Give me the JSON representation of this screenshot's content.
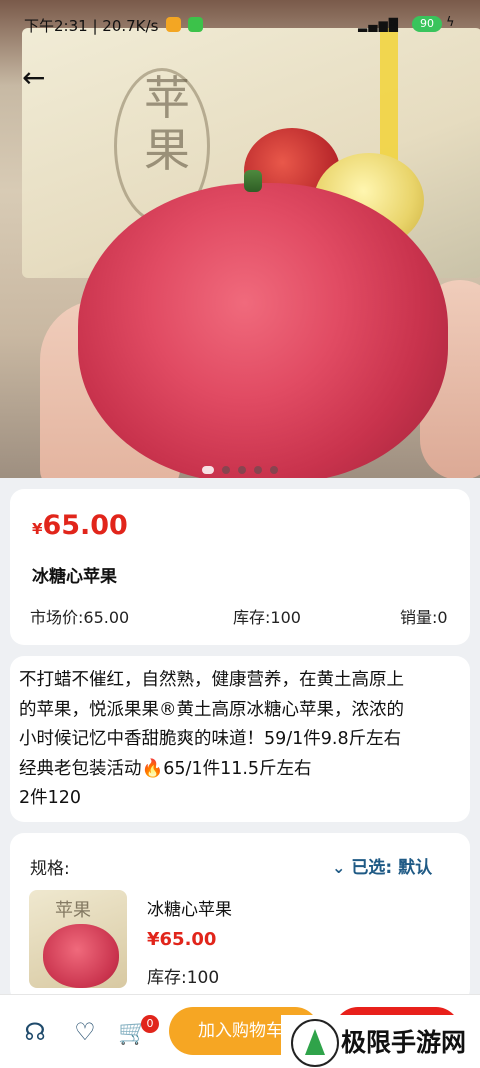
{
  "status_bar": {
    "time": "下午2:31 | 20.7K/s",
    "battery": "90"
  },
  "hero": {
    "carousel_total": 5,
    "carousel_active": 1
  },
  "product": {
    "currency": "¥",
    "price": "65.00",
    "name": "冰糖心苹果",
    "market_price": "市场价:65.00",
    "stock": "库存:100",
    "sales": "销量:0"
  },
  "description": {
    "lines": [
      "不打蜡不催红，自然熟，健康营养，在黄土高原上",
      "的苹果，悦派果果®黄土高原冰糖心苹果，浓浓的",
      "小时候记忆中香甜脆爽的味道！59/1件9.8斤左右",
      "经典老包装活动🔥65/1件11.5斤左右",
      "2件120"
    ]
  },
  "spec": {
    "label": "规格:",
    "selected": "已选:  默认",
    "item_name": "冰糖心苹果",
    "item_price": "¥65.00",
    "item_stock": "库存:100"
  },
  "bottom_bar": {
    "cart_badge": "0",
    "add_to_cart": "加入购物车"
  },
  "watermark": {
    "text": "极限手游网"
  },
  "colors": {
    "price_red": "#e1251b",
    "accent_blue": "#1f5a85",
    "cart_orange": "#f6a623",
    "buy_red": "#e8201b"
  }
}
